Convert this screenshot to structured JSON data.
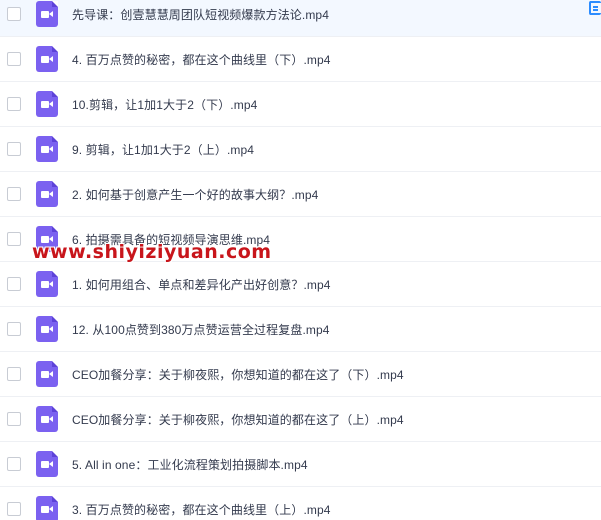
{
  "files": [
    {
      "name": "先导课：创壹慧慧周团队短视频爆款方法论.mp4",
      "icon": "video-file-icon"
    },
    {
      "name": "4. 百万点赞的秘密，都在这个曲线里（下）.mp4",
      "icon": "video-file-icon"
    },
    {
      "name": "10.剪辑，让1加1大于2（下）.mp4",
      "icon": "video-file-icon"
    },
    {
      "name": "9. 剪辑，让1加1大于2（上）.mp4",
      "icon": "video-file-icon"
    },
    {
      "name": "2. 如何基于创意产生一个好的故事大纲？.mp4",
      "icon": "video-file-icon"
    },
    {
      "name": "6. 拍摄需具备的短视频导演思维.mp4",
      "icon": "video-file-icon"
    },
    {
      "name": "1. 如何用组合、单点和差异化产出好创意？.mp4",
      "icon": "video-file-icon"
    },
    {
      "name": "12. 从100点赞到380万点赞运营全过程复盘.mp4",
      "icon": "video-file-icon"
    },
    {
      "name": "CEO加餐分享：关于柳夜熙，你想知道的都在这了（下）.mp4",
      "icon": "video-file-icon"
    },
    {
      "name": "CEO加餐分享：关于柳夜熙，你想知道的都在这了（上）.mp4",
      "icon": "video-file-icon"
    },
    {
      "name": "5. All in one：工业化流程策划拍摄脚本.mp4",
      "icon": "video-file-icon"
    },
    {
      "name": "3. 百万点赞的秘密，都在这个曲线里（上）.mp4",
      "icon": "video-file-icon"
    }
  ],
  "watermark": "www.shiyiziyuan.com",
  "colors": {
    "video_icon": "#7b61f0",
    "selected_row": "#f3f8ff",
    "text": "#333a4d",
    "accent": "#2b8cff",
    "watermark": "#c8151b"
  }
}
